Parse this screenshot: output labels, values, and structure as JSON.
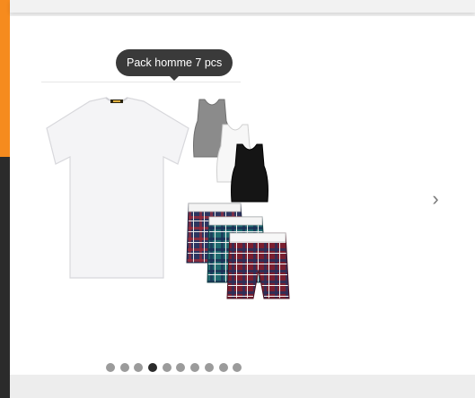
{
  "tooltip": {
    "text": "Pack homme 7 pcs"
  },
  "carousel": {
    "next_arrow": "›",
    "dots_total": 10,
    "active_index": 3
  },
  "product_image": {
    "icons": [
      "tshirt-icon",
      "tank-top-icon",
      "boxer-shorts-icon"
    ],
    "colors": {
      "tshirt": "#f4f4f6",
      "tank_grey": "#8b8b8b",
      "tank_white": "#f7f7f7",
      "tank_black": "#151515",
      "boxer_navy": "#2c3560",
      "boxer_teal": "#1f6a6f",
      "boxer_red": "#7a1f30"
    }
  },
  "colors": {
    "accent": "#f68b1e",
    "sidebar": "#2b2b2b",
    "tooltip_bg": "#3a3a3a",
    "dot": "#9b9b9b",
    "dot_active": "#2b2b2b"
  }
}
